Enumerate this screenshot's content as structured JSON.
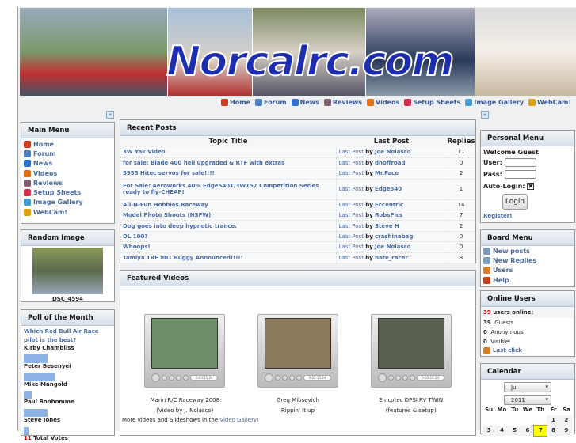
{
  "site": {
    "logo": "Norcalrc.com"
  },
  "topnav": [
    {
      "label": "Home",
      "color": "#d04020"
    },
    {
      "label": "Forum",
      "color": "#5080c0"
    },
    {
      "label": "News",
      "color": "#3070d0"
    },
    {
      "label": "Reviews",
      "color": "#806070"
    },
    {
      "label": "Videos",
      "color": "#e07010"
    },
    {
      "label": "Setup Sheets",
      "color": "#d03050"
    },
    {
      "label": "Image Gallery",
      "color": "#40a0d0"
    },
    {
      "label": "WebCam!",
      "color": "#e0a010"
    }
  ],
  "main_menu": {
    "title": "Main Menu",
    "items": [
      "Home",
      "Forum",
      "News",
      "Videos",
      "Reviews",
      "Setup Sheets",
      "Image Gallery",
      "WebCam!"
    ]
  },
  "random_image": {
    "title": "Random Image",
    "caption": "DSC_4594"
  },
  "poll": {
    "title": "Poll of the Month",
    "question": "Which Red Bull Air Race pilot is the best?",
    "options": [
      {
        "name": "Kirby Chambliss",
        "percent": 27
      },
      {
        "name": "Peter Besenyei",
        "percent": 36
      },
      {
        "name": "Mike Mangold",
        "percent": 9
      },
      {
        "name": "Paul Bonhomme",
        "percent": 27
      },
      {
        "name": "Steve Jones",
        "percent": 3
      }
    ],
    "total": "11",
    "total_label": "Total Votes"
  },
  "recent": {
    "title": "Recent Posts",
    "headers": [
      "Topic Title",
      "Last Post",
      "Replies"
    ],
    "last_post_label": "Last Post",
    "by": "by",
    "rows": [
      {
        "topic": "3W Yak Video",
        "user": "Joe Nolasco",
        "replies": "11"
      },
      {
        "topic": "for sale: Blade 400 heli upgraded & RTF with extras",
        "user": "dhoffroad",
        "replies": "0"
      },
      {
        "topic": "5955 Hitec servos for sale!!!!",
        "user": "Mr.Face",
        "replies": "2"
      },
      {
        "topic": "For Sale: Aeroworks 40% Edge540T/3W157 Competition Series ready to fly-CHEAP!",
        "user": "Edge540",
        "replies": "1"
      },
      {
        "topic": "All-N-Fun Hobbies Raceway",
        "user": "Eccentric",
        "replies": "14"
      },
      {
        "topic": "Model Photo Shoots (NSFW)",
        "user": "RobsPics",
        "replies": "7"
      },
      {
        "topic": "Dog goes into deep hypnotic trance.",
        "user": "Steve H",
        "replies": "2"
      },
      {
        "topic": "DL 100?",
        "user": "crashinabag",
        "replies": "0"
      },
      {
        "topic": "Whoops!",
        "user": "Joe Nolasco",
        "replies": "0"
      },
      {
        "topic": "Tamiya TRF 801 Buggy Announced!!!!!",
        "user": "nate_racer",
        "replies": "3"
      }
    ]
  },
  "videos": {
    "title": "Featured Videos",
    "time": "0:03:15.24",
    "items": [
      {
        "line1": "Marin R/C Raceway 2008",
        "line2": "(Video by J. Nolasco)",
        "bg": "#6f8f6a"
      },
      {
        "line1": "Greg Mibsevich",
        "line2": "Rippin' It up",
        "bg": "#8a7a5a"
      },
      {
        "line1": "Emcotec DPSI RV TWIN",
        "line2": "(features & setup)",
        "bg": "#5a6050"
      }
    ],
    "more_text": "More videos and Slideshows in the ",
    "more_link": "Video Gallery!"
  },
  "personal": {
    "title": "Personal Menu",
    "welcome": "Welcome Guest",
    "user_label": "User:",
    "pass_label": "Pass:",
    "auto_label": "Auto-Login:",
    "login": "Login",
    "register": "Register!"
  },
  "board": {
    "title": "Board Menu",
    "items": [
      "New posts",
      "New Replies",
      "Users",
      "Help"
    ]
  },
  "online": {
    "title": "Online Users",
    "count": "39",
    "count_label": "users online:",
    "guests": "39",
    "guests_label": "Guests",
    "anon": "0",
    "anon_label": "Anonymous",
    "visible": "0",
    "visible_label": "Visible:",
    "last_click": "Last click"
  },
  "calendar": {
    "title": "Calendar",
    "month": "Jul",
    "year": "2011",
    "days": [
      "Su",
      "Mo",
      "Tu",
      "We",
      "Th",
      "Fr",
      "Sa"
    ],
    "dates": [
      "",
      "",
      "",
      "",
      "",
      "1",
      "2",
      "3",
      "4",
      "5",
      "6",
      "7",
      "8",
      "9"
    ],
    "today": "7"
  }
}
